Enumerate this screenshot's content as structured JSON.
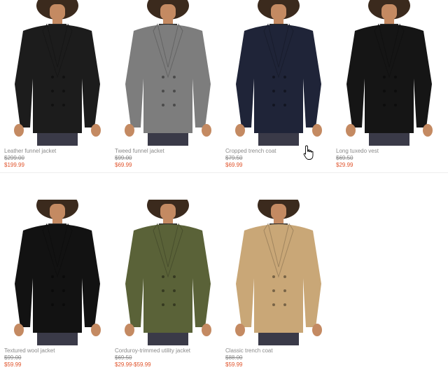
{
  "colors": {
    "accent_price": "#e0522a",
    "muted_text": "#8a8a8a"
  },
  "products": [
    {
      "name": "Leather funnel jacket",
      "original_price": "$299.00",
      "sale_price": "$199.99",
      "garment_color": "#1c1c1c",
      "icon": "leather-jacket-photo"
    },
    {
      "name": "Tweed funnel jacket",
      "original_price": "$99.00",
      "sale_price": "$69.99",
      "garment_color": "#7d7d7d",
      "icon": "tweed-jacket-photo"
    },
    {
      "name": "Cropped trench coat",
      "original_price": "$79.50",
      "sale_price": "$69.99",
      "garment_color": "#1f2438",
      "icon": "cropped-trench-photo"
    },
    {
      "name": "Long tuxedo vest",
      "original_price": "$69.50",
      "sale_price": "$29.99",
      "garment_color": "#151515",
      "icon": "tuxedo-vest-photo"
    },
    {
      "name": "Textured wool jacket",
      "original_price": "$99.00",
      "sale_price": "$59.99",
      "garment_color": "#121212",
      "icon": "wool-jacket-photo"
    },
    {
      "name": "Corduroy-trimmed utility jacket",
      "original_price": "$69.50",
      "sale_price": "$29.99-$59.99",
      "garment_color": "#5a6238",
      "icon": "utility-jacket-photo"
    },
    {
      "name": "Classic trench coat",
      "original_price": "$88.00",
      "sale_price": "$59.99",
      "garment_color": "#c9a777",
      "icon": "classic-trench-photo"
    }
  ]
}
